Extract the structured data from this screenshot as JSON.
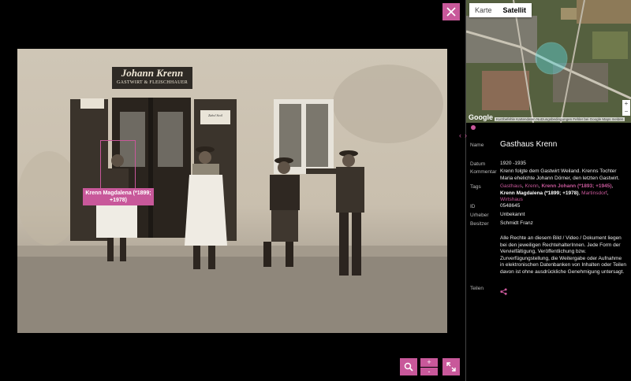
{
  "viewer": {
    "face_label": "Krenn Magdalena (*1899; +1978)",
    "sign_line1": "Johann Krenn",
    "sign_line2": "GASTWIRT & FLEISCHHAUER",
    "door_placard": "Zahol Stoil",
    "zoom_in": "+",
    "zoom_out": "-"
  },
  "map": {
    "tabs": [
      {
        "label": "Karte",
        "active": false
      },
      {
        "label": "Satellit",
        "active": true
      }
    ],
    "google": "Google",
    "footer": "Kurzbefehle  Kartendaten  Nutzungsbedingungen  Fehler bei Google Maps melden",
    "zoom_plus": "+",
    "zoom_minus": "−"
  },
  "details": {
    "name_label": "Name",
    "name": "Gasthaus Krenn",
    "date_label": "Datum",
    "date": "1920 -1935",
    "comment_label": "Kommentar",
    "comment": "Krenn folgte dem Gastwirt Weiland. Krenns Tochter Maria ehelichte Johann Dörner, den letzten Gastwirt.",
    "tags_label": "Tags",
    "tags": [
      {
        "text": "Gasthaus",
        "style": "link"
      },
      {
        "text": "Krenn",
        "style": "link"
      },
      {
        "text": "Krenn Johann (*1893; +1945)",
        "style": "strong-link"
      },
      {
        "text": "Krenn Magdalena (*1899; +1978)",
        "style": "strong"
      },
      {
        "text": "Martinsdorf",
        "style": "link"
      },
      {
        "text": "Wirtshaus",
        "style": "link"
      }
    ],
    "id_label": "ID",
    "id": "0548645",
    "author_label": "Urheber",
    "author": "Unbekannt",
    "owner_label": "Besitzer",
    "owner": "Schmidt Franz",
    "rights": "Alle Rechte an diesem Bild / Video / Dokument liegen bei den jeweiligen RechtehalterInnen. Jede Form der Vervielfältigung, Veröffentlichung bzw. Zurverfügungstellung, die Weitergabe oder Aufnahme in elektronischen Datenbanken von Inhalten oder Teilen davon ist ohne ausdrückliche Genehmigung untersagt.",
    "share_label": "Teilen"
  },
  "colors": {
    "accent": "#c8589a",
    "background": "#000000"
  }
}
